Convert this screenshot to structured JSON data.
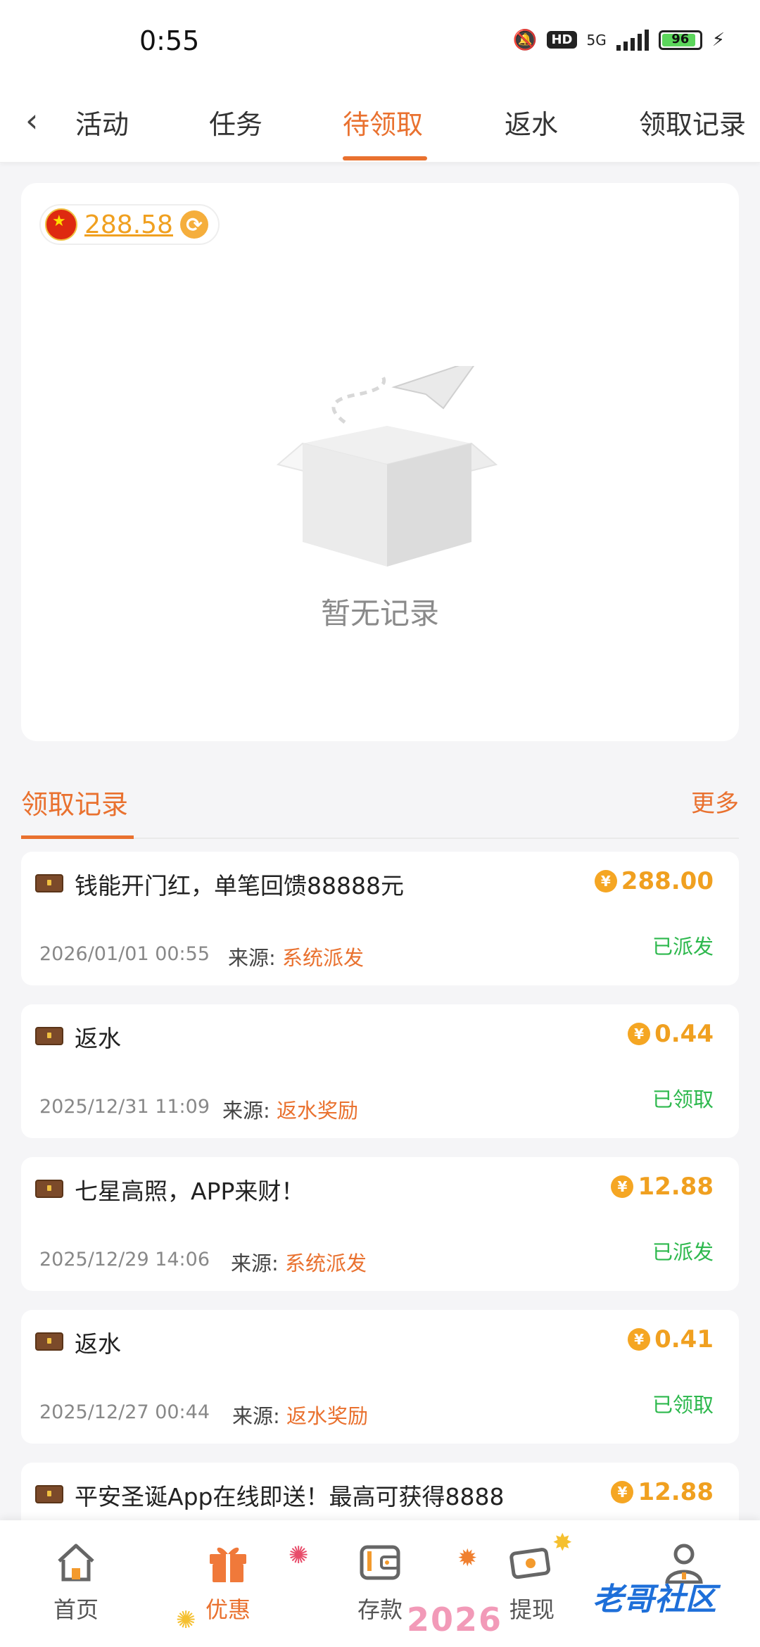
{
  "status_bar": {
    "time": "0:55",
    "hd_label": "HD",
    "network_label": "5G",
    "battery": "96"
  },
  "tabs": {
    "activity": "活动",
    "task": "任务",
    "pending": "待领取",
    "rebate": "返水",
    "records": "领取记录"
  },
  "balance": {
    "amount": "288.58"
  },
  "empty_state": {
    "text": "暂无记录"
  },
  "section": {
    "title": "领取记录",
    "more": "更多"
  },
  "records": [
    {
      "title": "钱能开门红，单笔回馈88888元",
      "amount": "288.00",
      "date": "2026/01/01 00:55",
      "source_label": "来源:",
      "source": "系统派发",
      "status": "已派发"
    },
    {
      "title": "返水",
      "amount": "0.44",
      "date": "2025/12/31 11:09",
      "source_label": "来源:",
      "source": "返水奖励",
      "status": "已领取"
    },
    {
      "title": "七星高照，APP来财！",
      "amount": "12.88",
      "date": "2025/12/29 14:06",
      "source_label": "来源:",
      "source": "系统派发",
      "status": "已派发"
    },
    {
      "title": "返水",
      "amount": "0.41",
      "date": "2025/12/27 00:44",
      "source_label": "来源:",
      "source": "返水奖励",
      "status": "已领取"
    },
    {
      "title": "平安圣诞App在线即送！最高可获得8888",
      "amount": "12.88"
    }
  ],
  "bottom_nav": {
    "home": "首页",
    "promo": "优惠",
    "deposit": "存款",
    "withdraw": "提现",
    "profile": ""
  },
  "decor": {
    "year": "2026",
    "watermark": "老哥社区"
  },
  "colors": {
    "accent": "#e9712f",
    "gold": "#f0a020",
    "green": "#2db84d"
  },
  "icons": [
    "back-arrow-icon",
    "china-flag-icon",
    "refresh-icon",
    "empty-box-icon",
    "chest-icon",
    "yen-coin-icon",
    "home-icon",
    "gift-icon",
    "wallet-icon",
    "cash-icon",
    "user-icon"
  ]
}
